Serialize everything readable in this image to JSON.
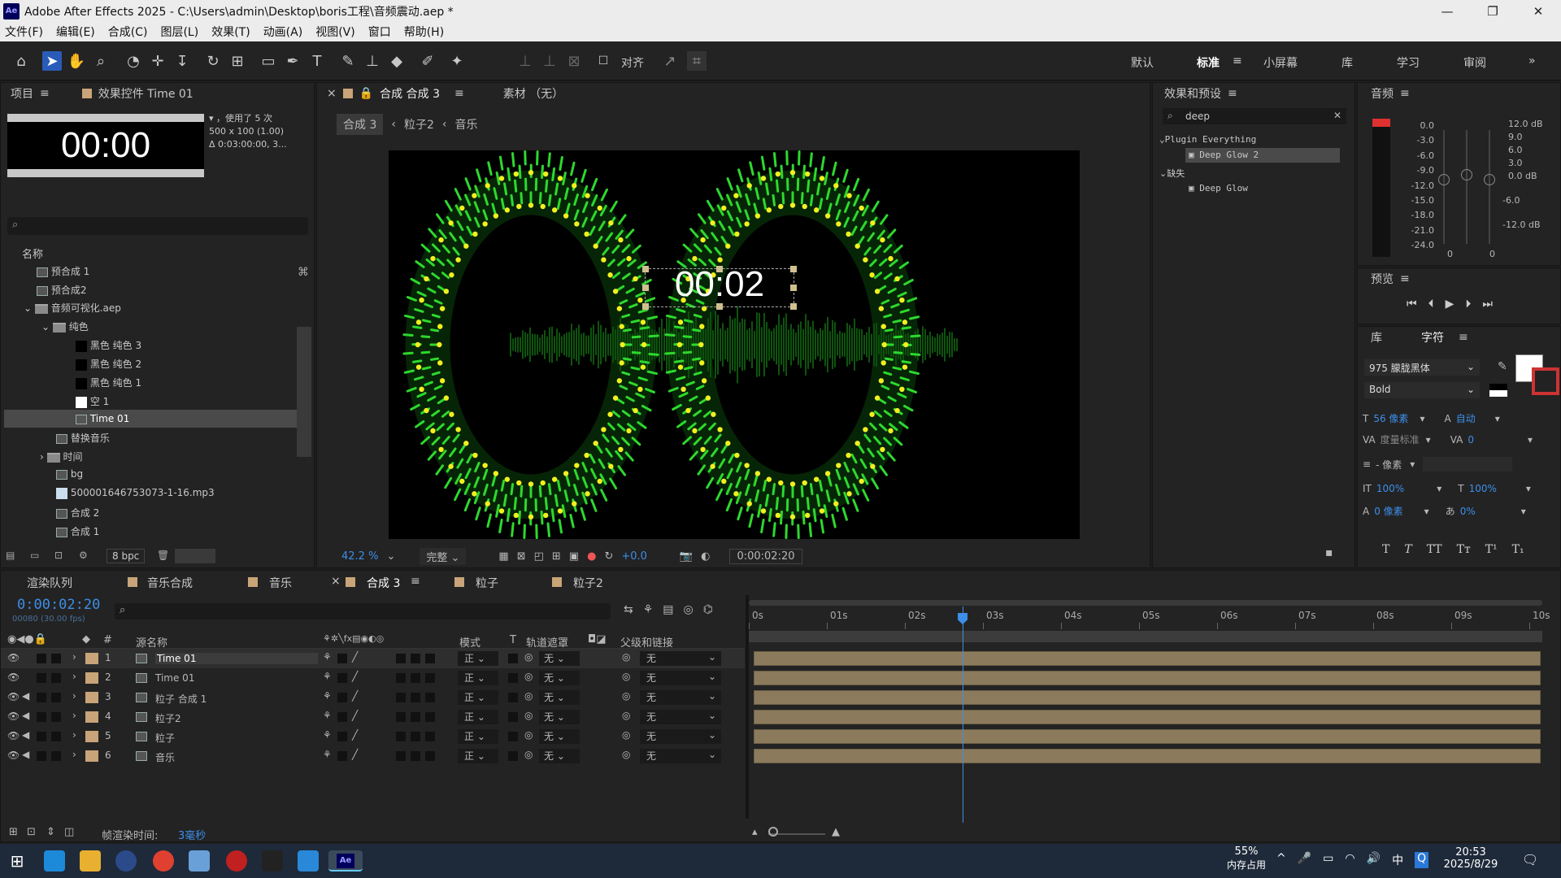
{
  "app": {
    "title": "Adobe After Effects 2025 - C:\\Users\\admin\\Desktop\\boris工程\\音频震动.aep *",
    "logo": "Ae"
  },
  "menu": [
    "文件(F)",
    "编辑(E)",
    "合成(C)",
    "图层(L)",
    "效果(T)",
    "动画(A)",
    "视图(V)",
    "窗口",
    "帮助(H)"
  ],
  "toolbar": {
    "align_label": "对齐",
    "workspaces": [
      "默认",
      "标准",
      "小屏幕",
      "库",
      "学习",
      "审阅"
    ],
    "active_workspace": "标准"
  },
  "project": {
    "tab_label": "项目",
    "effects_tab": "效果控件 Time 01",
    "thumb_time": "00:00",
    "info": [
      "，使用了 5 次",
      "500 x 100 (1.00)",
      "Δ 0:03:00:00, 3..."
    ],
    "search_placeholder": "",
    "col_name": "名称",
    "items": [
      "预合成 1",
      "预合成2",
      "音频可视化.aep",
      "纯色",
      "黑色 纯色 3",
      "黑色 纯色 2",
      "黑色 纯色 1",
      "空 1",
      "Time 01",
      "替换音乐",
      "时间",
      "bg",
      "500001646753073-1-16.mp3",
      "合成 2",
      "合成 1"
    ],
    "bpc": "8 bpc"
  },
  "comp": {
    "tab_label": "合成 合成 3",
    "footage_label": "素材 （无）",
    "breadcrumb": [
      "合成 3",
      "粒子2",
      "音乐"
    ],
    "overlay_time": "00:02",
    "zoom": "42.2 %",
    "quality": "完整",
    "exposure": "+0.0",
    "timecode": "0:00:02:20"
  },
  "effects": {
    "title": "效果和预设",
    "search": "deep",
    "groups": [
      {
        "name": "Plugin Everything",
        "items": [
          "Deep Glow 2"
        ]
      },
      {
        "name": "缺失",
        "items": [
          "Deep Glow"
        ]
      }
    ]
  },
  "audio": {
    "title": "音频",
    "left_scale": [
      "0.0",
      "-3.0",
      "-6.0",
      "-9.0",
      "-12.0",
      "-15.0",
      "-18.0",
      "-21.0",
      "-24.0"
    ],
    "right_scale": [
      "12.0 dB",
      "9.0",
      "6.0",
      "3.0",
      "0.0 dB",
      "-6.0",
      "-12.0 dB"
    ],
    "knob_values": [
      "0",
      "0"
    ]
  },
  "preview": {
    "title": "预览"
  },
  "character": {
    "lib_tab": "库",
    "title": "字符",
    "font": "975 朦胧黑体",
    "style": "Bold",
    "size": "56 像素",
    "leading": "自动",
    "kerning": "度量标准",
    "tracking": "0",
    "stroke": "- 像素",
    "vscale": "100%",
    "hscale": "100%",
    "baseline": "0 像素",
    "tsume": "0%",
    "styles": [
      "T",
      "T",
      "TT",
      "Tт",
      "T¹",
      "T₁"
    ]
  },
  "timeline": {
    "tabs": [
      "渲染队列",
      "音乐合成",
      "音乐",
      "合成 3",
      "粒子",
      "粒子2"
    ],
    "active_tab": "合成 3",
    "timecode": "0:00:02:20",
    "fps": "00080 (30.00 fps)",
    "columns": {
      "num": "#",
      "source": "源名称",
      "mode": "模式",
      "t": "T",
      "matte": "轨道遮罩",
      "parent": "父级和链接"
    },
    "ruler": [
      "0s",
      "01s",
      "02s",
      "03s",
      "04s",
      "05s",
      "06s",
      "07s",
      "08s",
      "09s",
      "10s"
    ],
    "layers": [
      {
        "n": "1",
        "name": "Time 01",
        "mode": "正",
        "matte": "无",
        "parent": "无"
      },
      {
        "n": "2",
        "name": "Time 01",
        "mode": "正",
        "matte": "无",
        "parent": "无"
      },
      {
        "n": "3",
        "name": "粒子 合成 1",
        "mode": "正",
        "matte": "无",
        "parent": "无"
      },
      {
        "n": "4",
        "name": "粒子2",
        "mode": "正",
        "matte": "无",
        "parent": "无"
      },
      {
        "n": "5",
        "name": "粒子",
        "mode": "正",
        "matte": "无",
        "parent": "无"
      },
      {
        "n": "6",
        "name": "音乐",
        "mode": "正",
        "matte": "无",
        "parent": "无"
      }
    ],
    "render_label": "帧渲染时间:",
    "render_value": "3毫秒"
  },
  "taskbar": {
    "mem_pct": "55%",
    "mem_label": "内存占用",
    "time": "20:53",
    "date": "2025/8/29",
    "ime": "中"
  },
  "colors": {
    "accent": "#2d8ceb",
    "glow": "#22cc22",
    "dot": "#f0f020",
    "label_tan": "#c8a478"
  }
}
